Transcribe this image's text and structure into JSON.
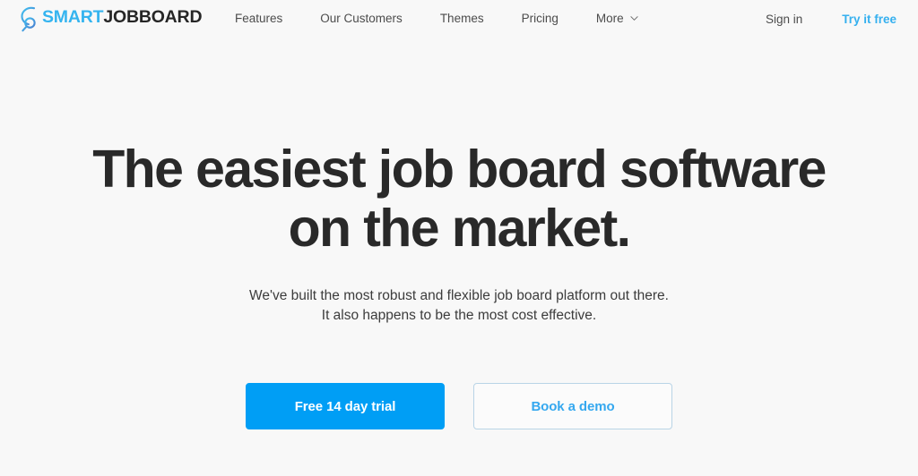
{
  "brand": {
    "icon": "magnifier-logo-icon",
    "word_primary": "SMART",
    "word_secondary": "JOBBOARD",
    "color_primary": "#35b4ef",
    "color_secondary": "#262626"
  },
  "header": {
    "nav": [
      {
        "label": "Features",
        "has_dropdown": false
      },
      {
        "label": "Our Customers",
        "has_dropdown": false
      },
      {
        "label": "Themes",
        "has_dropdown": false
      },
      {
        "label": "Pricing",
        "has_dropdown": false
      },
      {
        "label": "More",
        "has_dropdown": true,
        "icon": "chevron-down-icon"
      }
    ],
    "sign_in_label": "Sign in",
    "try_free_label": "Try it free",
    "try_free_color": "#35b0ef"
  },
  "hero": {
    "title_line1": "The easiest job board software",
    "title_line2": "on the market.",
    "title_color": "#292929",
    "subtitle_line1": "We've built the most robust and flexible job board platform out there.",
    "subtitle_line2": "It also happens to be the most cost effective.",
    "subtitle_color": "#3c3c3c",
    "primary_cta": {
      "label": "Free 14 day trial",
      "background": "#009ef5",
      "text_color": "#ffffff"
    },
    "secondary_cta": {
      "label": "Book a demo",
      "background": "#fbfbfb",
      "text_color": "#35a8ef",
      "border_color": "#b9d4e6"
    }
  },
  "page": {
    "background": "#f8f8f8"
  }
}
